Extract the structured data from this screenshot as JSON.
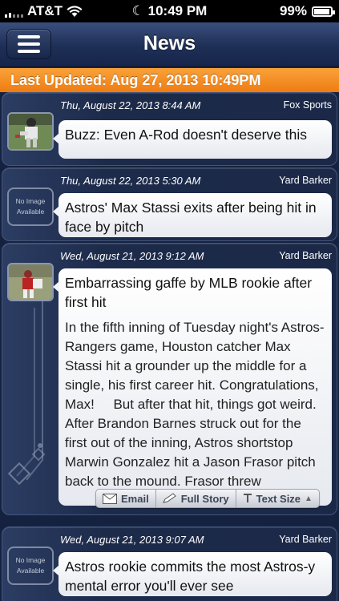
{
  "status_bar": {
    "carrier": "AT&T",
    "time": "10:49 PM",
    "battery": "99%"
  },
  "nav": {
    "title": "News"
  },
  "updated": {
    "text": "Last Updated: Aug 27, 2013 10:49PM"
  },
  "articles": [
    {
      "date": "Thu, August 22, 2013 8:44 AM",
      "source": "Fox Sports",
      "headline": "Buzz: Even A-Rod doesn't deserve this",
      "thumbnail": "photo"
    },
    {
      "date": "Thu, August 22, 2013 5:30 AM",
      "source": "Yard Barker",
      "headline": "Astros' Max Stassi exits after being hit in face by pitch",
      "thumbnail": "No Image Available"
    },
    {
      "date": "Wed, August 21, 2013 9:12 AM",
      "source": "Yard Barker",
      "headline": "Embarrassing gaffe by MLB rookie after first hit",
      "body": "In the fifth inning of Tuesday night's Astros-Rangers game, Houston catcher Max Stassi hit a grounder up the middle for a single, his first career hit. Congratulations, Max!     But after that hit, things got weird.                After Brandon Barnes struck out for the first out of the inning, Astros shortstop Marwin Gonzalez hit a Jason Frasor pitch back to the mound. Frasor threw",
      "thumbnail": "photo",
      "actions": {
        "email": "Email",
        "full_story": "Full Story",
        "text_size": "Text Size"
      }
    },
    {
      "date": "Wed, August 21, 2013 9:07 AM",
      "source": "Yard Barker",
      "headline": "Astros rookie commits the most Astros-y mental error you'll ever see",
      "thumbnail": "No Image Available"
    }
  ]
}
